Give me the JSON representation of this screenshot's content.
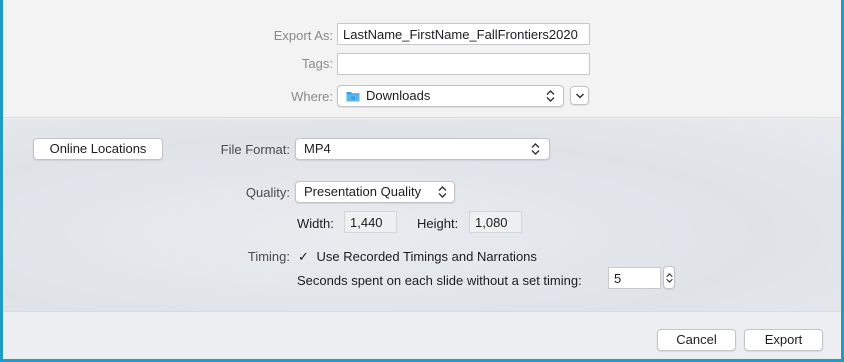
{
  "export": {
    "export_as_label": "Export As:",
    "export_as_value": "LastName_FirstName_FallFrontiers2020",
    "tags_label": "Tags:",
    "tags_value": "",
    "where_label": "Where:",
    "where_value": "Downloads",
    "where_icon": "folder-icon"
  },
  "options": {
    "online_locations_label": "Online Locations",
    "file_format_label": "File Format:",
    "file_format_value": "MP4",
    "quality_label": "Quality:",
    "quality_value": "Presentation Quality",
    "width_label": "Width:",
    "width_value": "1,440",
    "height_label": "Height:",
    "height_value": "1,080",
    "timing_label": "Timing:",
    "timing_check_mark": "✓",
    "timing_checkbox_label": "Use Recorded Timings and Narrations",
    "timing_checked": true,
    "seconds_label": "Seconds spent on each slide without a set timing:",
    "seconds_value": "5"
  },
  "footer": {
    "cancel_label": "Cancel",
    "export_label": "Export"
  },
  "colors": {
    "frame_border": "#1f9bc4",
    "folder_blue": "#3aa0e4"
  }
}
